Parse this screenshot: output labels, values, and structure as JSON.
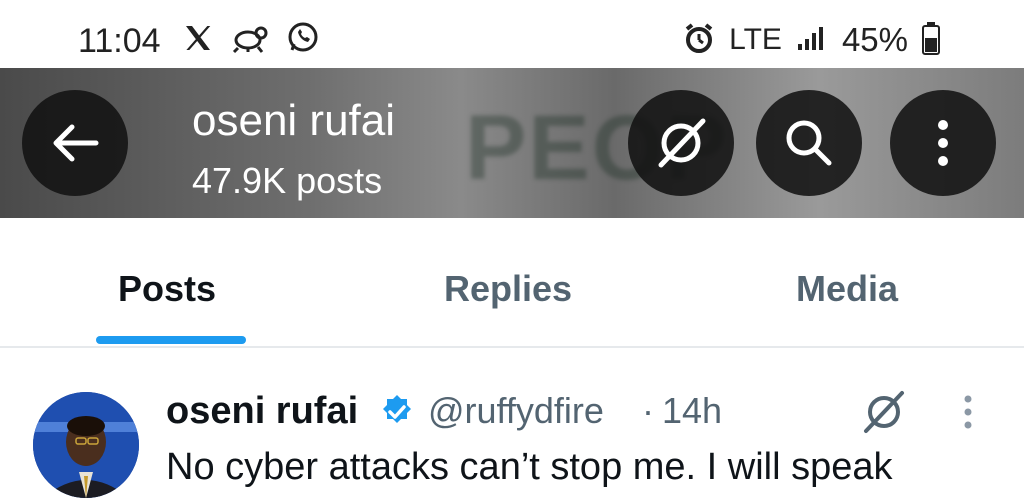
{
  "status_bar": {
    "time": "11:04",
    "network": "LTE",
    "battery": "45%",
    "left_icons": [
      "x-logo-icon",
      "bug-icon",
      "whatsapp-icon"
    ],
    "right_icons": [
      "alarm-icon",
      "signal-icon",
      "battery-icon"
    ]
  },
  "header": {
    "name": "oseni rufai",
    "post_count": "47.9K posts",
    "banner_text": "PEOP"
  },
  "tabs": [
    {
      "label": "Posts",
      "selected": true
    },
    {
      "label": "Replies",
      "selected": false
    },
    {
      "label": "Media",
      "selected": false
    }
  ],
  "post": {
    "author": "oseni rufai",
    "handle": "@ruffydfire",
    "separator": "·",
    "time": "14h",
    "text": "No cyber attacks can’t stop me. I will speak"
  },
  "colors": {
    "accent": "#1d9bf0",
    "text_primary": "#0f1419",
    "text_secondary": "#536471"
  }
}
